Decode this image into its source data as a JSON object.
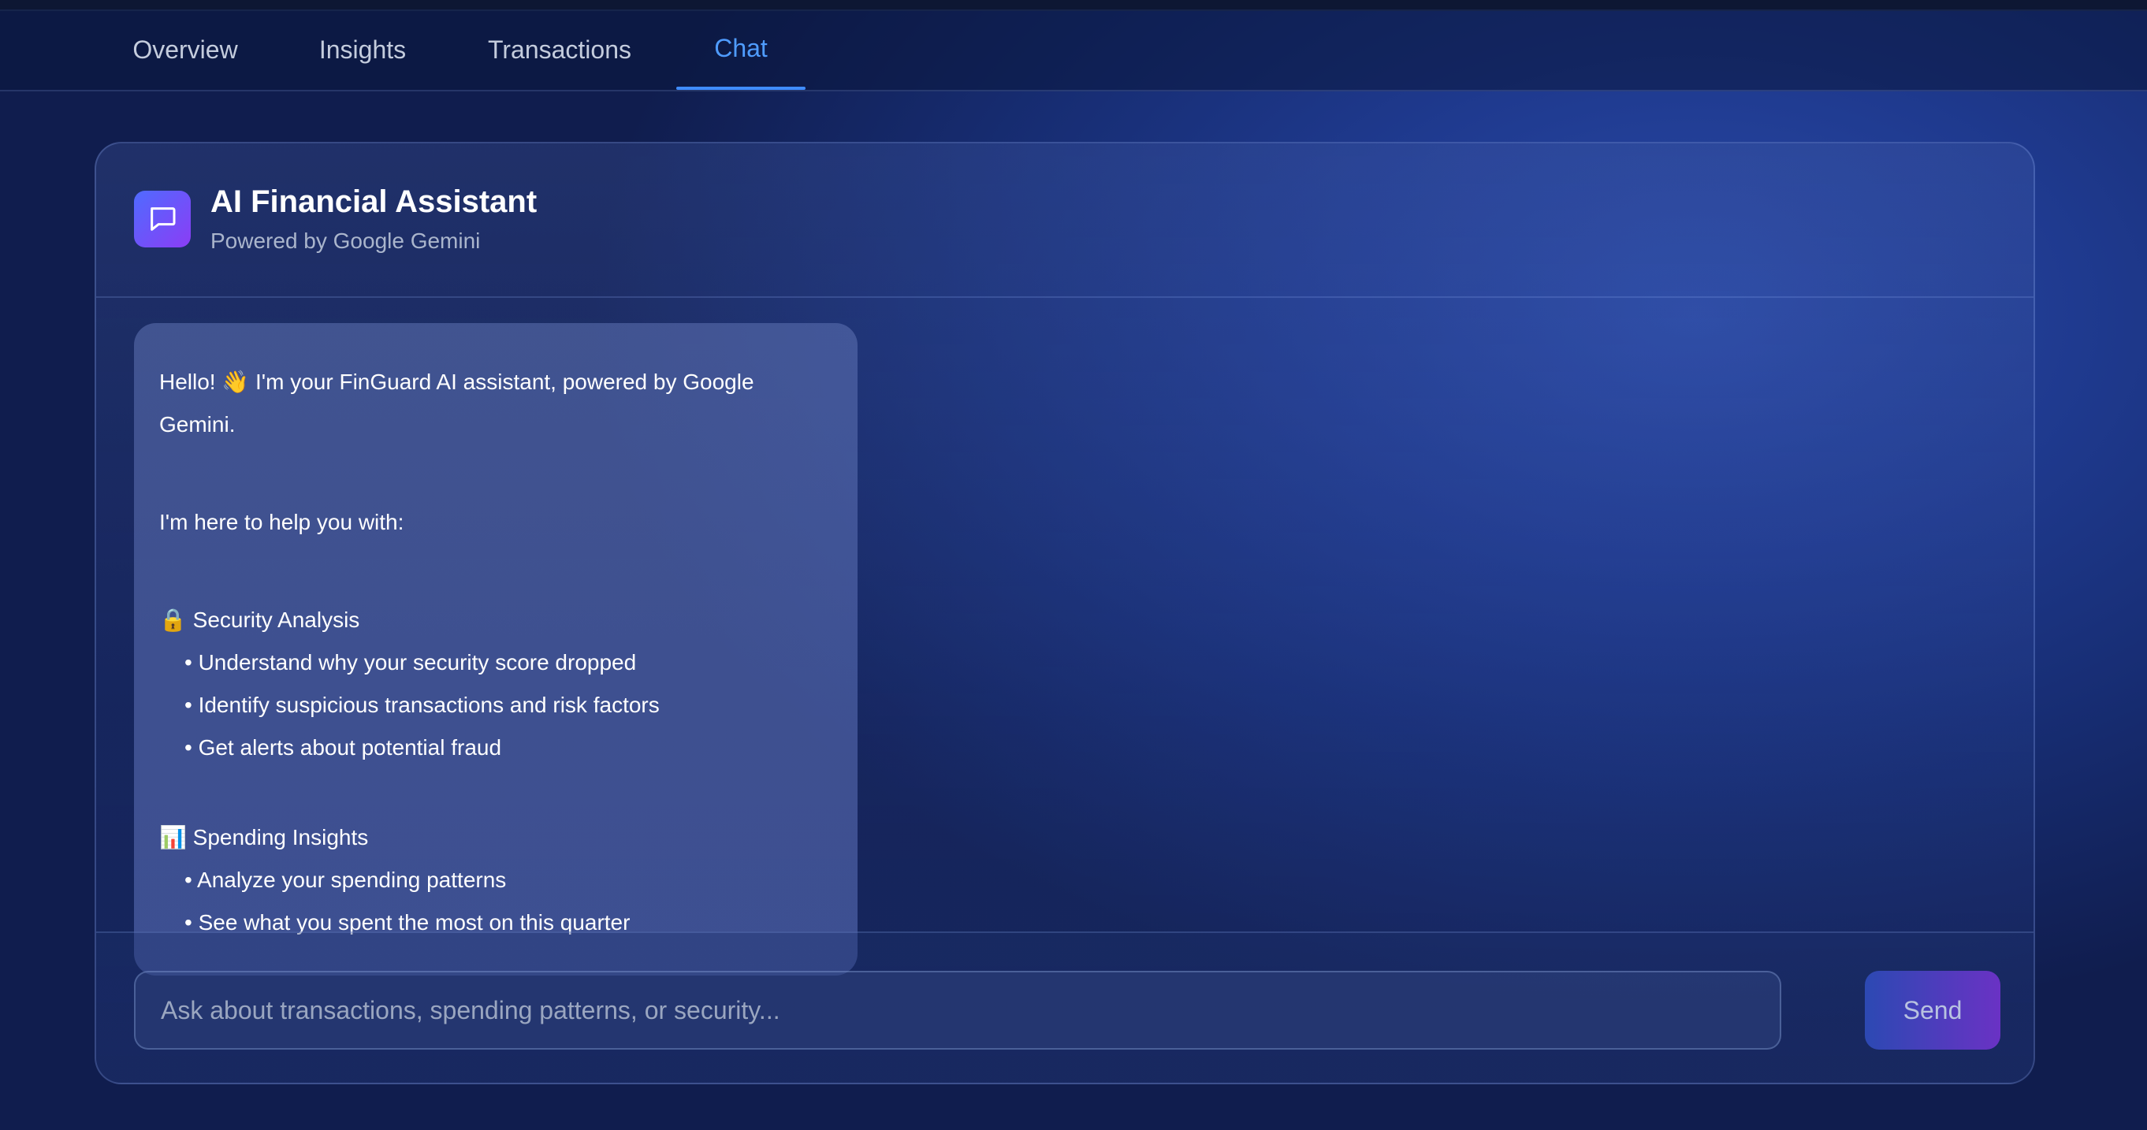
{
  "nav": {
    "tabs": [
      {
        "label": "Overview"
      },
      {
        "label": "Insights"
      },
      {
        "label": "Transactions"
      },
      {
        "label": "Chat",
        "active": true
      }
    ]
  },
  "chat": {
    "icon": "chat-bubble-icon",
    "title": "AI Financial Assistant",
    "subtitle": "Powered by Google Gemini",
    "message": {
      "greeting": "Hello! 👋 I'm your FinGuard AI assistant, powered by Google Gemini.",
      "intro": "I'm here to help you with:",
      "sections": [
        {
          "heading": "🔒 Security Analysis",
          "items": [
            "• Understand why your security score dropped",
            "• Identify suspicious transactions and risk factors",
            "• Get alerts about potential fraud"
          ]
        },
        {
          "heading": "📊 Spending Insights",
          "items": [
            "• Analyze your spending patterns",
            "• See what you spent the most on this quarter"
          ]
        }
      ]
    },
    "input_placeholder": "Ask about transactions, spending patterns, or security...",
    "input_value": "",
    "send_label": "Send"
  },
  "colors": {
    "accent": "#4f9cff",
    "icon_gradient_start": "#4f6bff",
    "icon_gradient_end": "#8b3df5"
  }
}
